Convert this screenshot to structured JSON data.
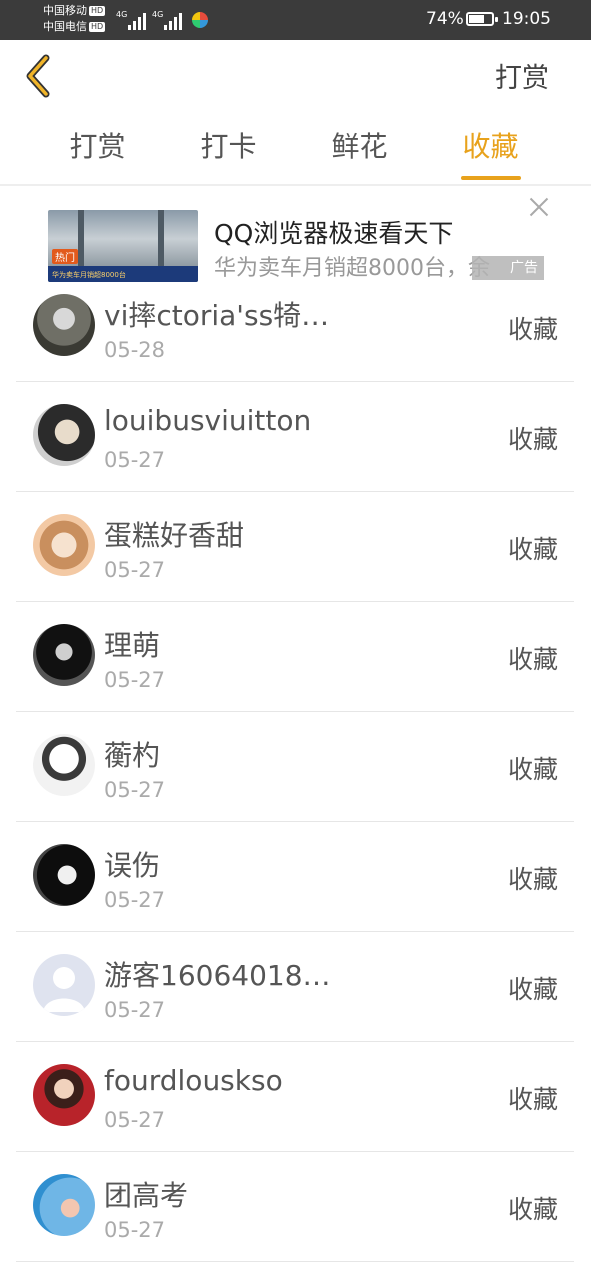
{
  "status_bar": {
    "carrier1": "中国移动",
    "carrier2": "中国电信",
    "hd_label": "HD",
    "network1": "4G",
    "network2": "4G",
    "battery_pct": "74%",
    "battery_level": 0.74,
    "time": "19:05"
  },
  "header": {
    "back_icon": "chevron-left-icon",
    "title": "打赏",
    "accent_color": "#e8a21c"
  },
  "tabs": [
    {
      "label": "打赏",
      "active": false
    },
    {
      "label": "打卡",
      "active": false
    },
    {
      "label": "鲜花",
      "active": false
    },
    {
      "label": "收藏",
      "active": true
    }
  ],
  "ad": {
    "thumb_badge": "热门",
    "thumb_text": "华为卖车月销超8000台",
    "title": "QQ浏览器极速看天下",
    "desc": "华为卖车月销超8000台，余",
    "tag": "广告"
  },
  "list": [
    {
      "name": "vi摔ctoria'ss犄…",
      "date": "05-28",
      "action": "收藏"
    },
    {
      "name": "louibusviuitton",
      "date": "05-27",
      "action": "收藏"
    },
    {
      "name": "蛋糕好香甜",
      "date": "05-27",
      "action": "收藏"
    },
    {
      "name": "理萌",
      "date": "05-27",
      "action": "收藏"
    },
    {
      "name": "蘅杓",
      "date": "05-27",
      "action": "收藏"
    },
    {
      "name": "误伤",
      "date": "05-27",
      "action": "收藏"
    },
    {
      "name": "游客16064018…",
      "date": "05-27",
      "action": "收藏"
    },
    {
      "name": "fourdlouskso",
      "date": "05-27",
      "action": "收藏"
    },
    {
      "name": "团高考",
      "date": "05-27",
      "action": "收藏"
    }
  ]
}
